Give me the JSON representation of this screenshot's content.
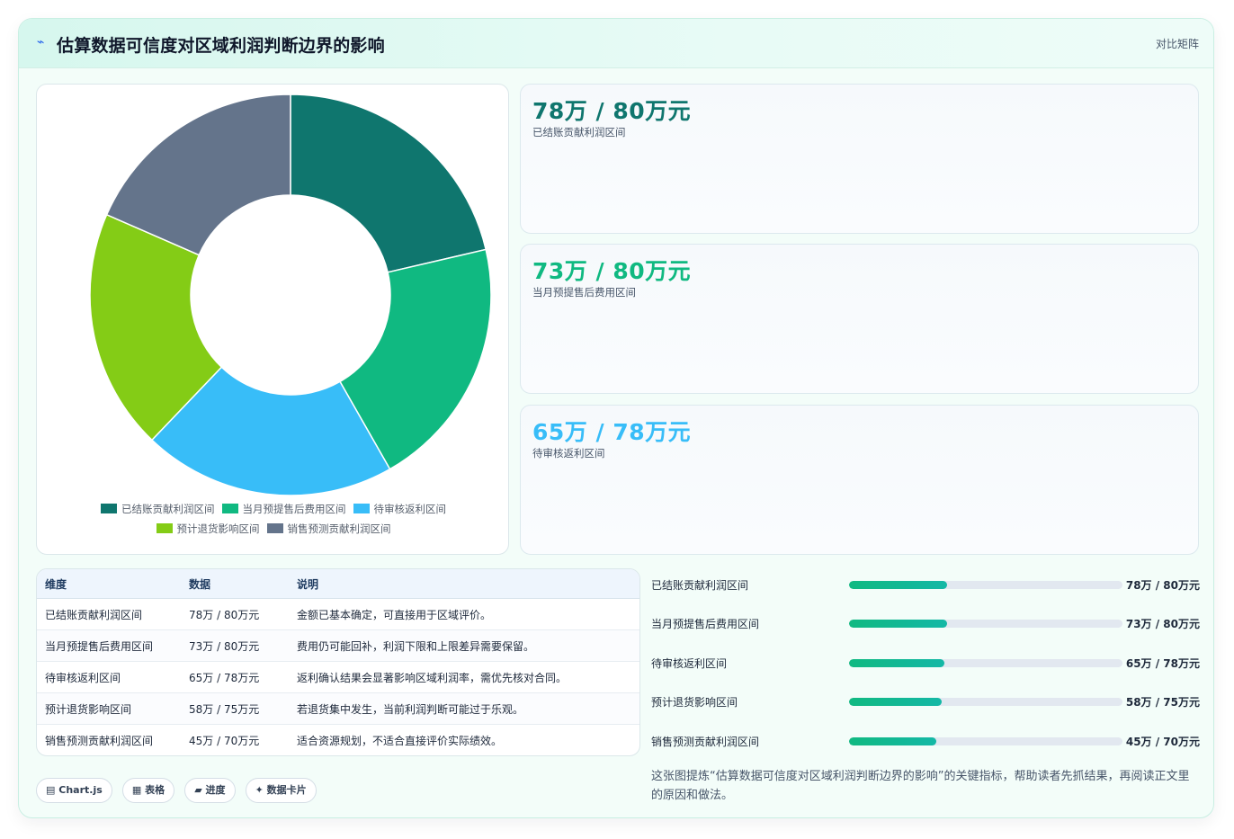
{
  "header": {
    "icon": "sparkle-icon",
    "title": "估算数据可信度对区域利润判断边界的影响",
    "link_label": "对比矩阵"
  },
  "chart_data": {
    "type": "pie",
    "categories": [
      "已结账贡献利润区间",
      "当月预提售后费用区间",
      "待审核返利区间",
      "预计退货影响区间",
      "销售预测贡献利润区间"
    ],
    "values": [
      22,
      21,
      21,
      20,
      19
    ],
    "colors": [
      "#0f766e",
      "#10b981",
      "#38bdf8",
      "#84cc16",
      "#64748b"
    ],
    "legend_position": "bottom"
  },
  "stats": [
    {
      "value": "78万 / 80万元",
      "label": "已结账贡献利润区间",
      "color": "#0f766e"
    },
    {
      "value": "73万 / 80万元",
      "label": "当月预提售后费用区间",
      "color": "#10b981"
    },
    {
      "value": "65万 / 78万元",
      "label": "待审核返利区间",
      "color": "#38bdf8"
    }
  ],
  "table": {
    "headers": [
      "维度",
      "数据",
      "说明"
    ],
    "rows": [
      [
        "已结账贡献利润区间",
        "78万 / 80万元",
        "金额已基本确定，可直接用于区域评价。"
      ],
      [
        "当月预提售后费用区间",
        "73万 / 80万元",
        "费用仍可能回补，利润下限和上限差异需要保留。"
      ],
      [
        "待审核返利区间",
        "65万 / 78万元",
        "返利确认结果会显著影响区域利润率，需优先核对合同。"
      ],
      [
        "预计退货影响区间",
        "58万 / 75万元",
        "若退货集中发生，当前利润判断可能过于乐观。"
      ],
      [
        "销售预测贡献利润区间",
        "45万 / 70万元",
        "适合资源规划，不适合直接评价实际绩效。"
      ]
    ]
  },
  "chips": [
    {
      "icon": "chart-icon",
      "glyph": "▤",
      "label": "Chart.js"
    },
    {
      "icon": "table-icon",
      "glyph": "▦",
      "label": "表格"
    },
    {
      "icon": "progress-icon",
      "glyph": "▰",
      "label": "进度"
    },
    {
      "icon": "sparkle-icon",
      "glyph": "✦",
      "label": "数据卡片"
    }
  ],
  "progress": [
    {
      "label": "已结账贡献利润区间",
      "value": "78万 / 80万元",
      "fraction": 0.36
    },
    {
      "label": "当月预提售后费用区间",
      "value": "73万 / 80万元",
      "fraction": 0.36
    },
    {
      "label": "待审核返利区间",
      "value": "65万 / 78万元",
      "fraction": 0.35
    },
    {
      "label": "预计退货影响区间",
      "value": "58万 / 75万元",
      "fraction": 0.34
    },
    {
      "label": "销售预测贡献利润区间",
      "value": "45万 / 70万元",
      "fraction": 0.32
    }
  ],
  "summary": "这张图提炼“估算数据可信度对区域利润判断边界的影响”的关键指标，帮助读者先抓结果，再阅读正文里的原因和做法。"
}
